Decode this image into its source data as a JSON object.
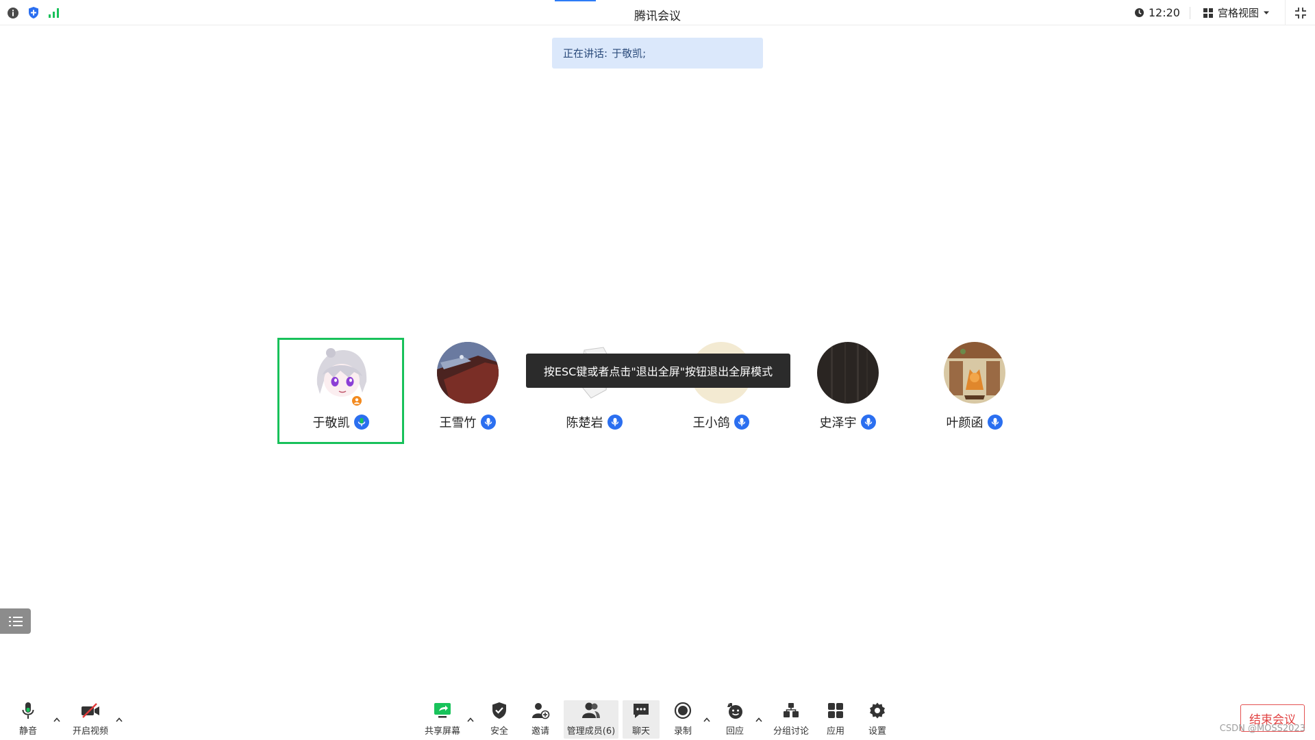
{
  "app": {
    "title": "腾讯会议"
  },
  "topbar": {
    "time": "12:20",
    "view_mode": "宫格视图"
  },
  "speaking": {
    "label": "正在讲话:",
    "name": "于敬凯;"
  },
  "participants": [
    {
      "name": "于敬凯"
    },
    {
      "name": "王雪竹"
    },
    {
      "name": "陈楚岩"
    },
    {
      "name": "王小鸽"
    },
    {
      "name": "史泽宇"
    },
    {
      "name": "叶颜函"
    }
  ],
  "tooltip": {
    "text": "按ESC键或者点击\"退出全屏\"按钮退出全屏模式"
  },
  "toolbar": {
    "mute": "静音",
    "video": "开启视频",
    "share": "共享屏幕",
    "security": "安全",
    "invite": "邀请",
    "members": "管理成员(6)",
    "chat": "聊天",
    "record": "录制",
    "react": "回应",
    "breakout": "分组讨论",
    "apps": "应用",
    "settings": "设置"
  },
  "end_meeting": "结束会议",
  "watermark": "CSDN @MOSS2023",
  "colors": {
    "accent": "#2b6ff0",
    "active_border": "#18c15a",
    "end": "#e14040"
  }
}
